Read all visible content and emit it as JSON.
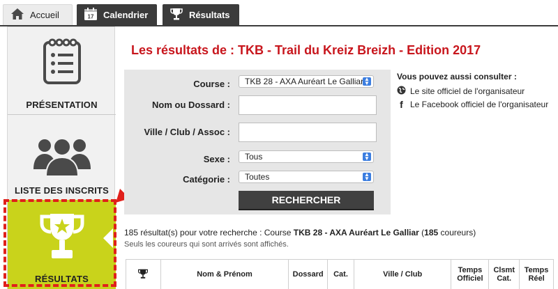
{
  "tabs": [
    {
      "label": "Accueil",
      "icon": "home-icon"
    },
    {
      "label": "Calendrier",
      "icon": "calendar-icon",
      "badge": "17"
    },
    {
      "label": "Résultats",
      "icon": "trophy-icon"
    }
  ],
  "sidebar": {
    "items": [
      {
        "label": "PRÉSENTATION",
        "icon": "clipboard-icon"
      },
      {
        "label": "LISTE DES INSCRITS",
        "icon": "people-icon"
      },
      {
        "label": "RÉSULTATS",
        "icon": "trophy-icon",
        "active": true
      }
    ]
  },
  "page": {
    "title": "Les résultats de : TKB - Trail du Kreiz Breizh - Edition 2017"
  },
  "form": {
    "course_label": "Course :",
    "course_value": "TKB 28 - AXA Auréart Le Galliar",
    "name_label": "Nom ou Dossard :",
    "name_value": "",
    "city_label": "Ville / Club / Assoc :",
    "city_value": "",
    "sex_label": "Sexe :",
    "sex_value": "Tous",
    "category_label": "Catégorie :",
    "category_value": "Toutes",
    "search_button": "RECHERCHER"
  },
  "consult": {
    "title": "Vous pouvez aussi consulter :",
    "links": [
      {
        "label": "Le site officiel de l'organisateur",
        "icon": "globe-icon"
      },
      {
        "label": "Le Facebook officiel de l'organisateur",
        "icon": "facebook-icon"
      }
    ]
  },
  "summary": {
    "prefix": "185 résultat(s) pour votre recherche : Course ",
    "course": "TKB 28 - AXA Auréart Le Galliar",
    "open_paren": " (",
    "count": "185",
    "suffix": " coureurs)",
    "note": "Seuls les coureurs qui sont arrivés sont affichés."
  },
  "table": {
    "columns": [
      "",
      "Nom & Prénom",
      "Dossard",
      "Cat.",
      "Ville / Club",
      "Temps Officiel",
      "Clsmt Cat.",
      "Temps Réel"
    ]
  },
  "colors": {
    "accent_red": "#c8161d",
    "active_green": "#c9d31b",
    "dark_tab": "#3b3b3b",
    "highlight_red": "#e0201b"
  }
}
